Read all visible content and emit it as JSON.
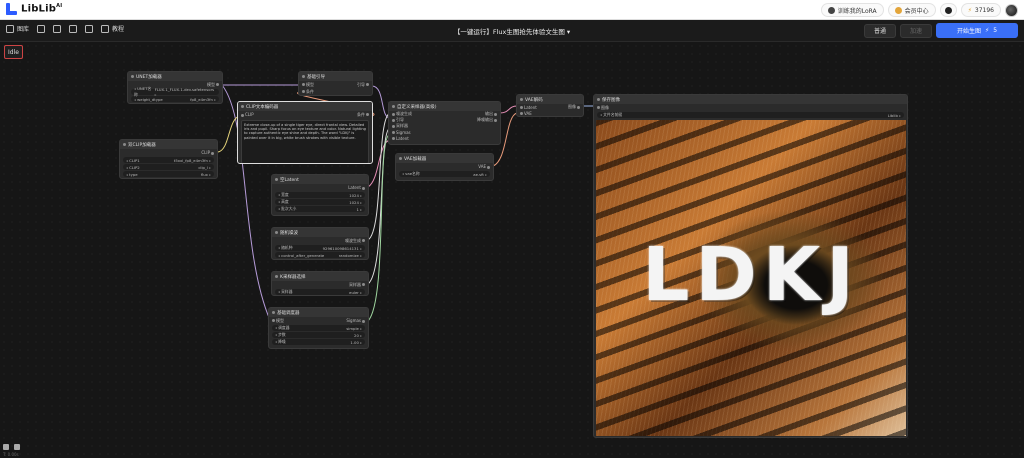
{
  "brand": {
    "logo_text": "LibLib",
    "logo_sup": "AI"
  },
  "topbar": {
    "train_lora": "训练我的LoRA",
    "member_center": "会员中心",
    "points": "37196"
  },
  "toolbar": {
    "library": "图库",
    "tutorial": "教程",
    "workflow_title": "【一键运行】Flux生图抢先体验文生图",
    "mode_normal": "普通",
    "mode_fast": "加速",
    "run_button": "开始生图",
    "run_cost": "5"
  },
  "canvas": {
    "status": "Idle",
    "footer_status": "T: 0.00s"
  },
  "nodes": {
    "unet": {
      "title": "UNET加载器",
      "out_model": "模型",
      "unet_name": "FLUX.1_FLUX.1-dev.safetensors",
      "unet_label": "UNET名称",
      "weight_dtype_label": "weight_dtype",
      "weight_dtype": "fp8_e4m3fn"
    },
    "dualclip": {
      "title": "双CLIP加载器",
      "out_clip": "CLIP",
      "clip1_label": "CLIP1",
      "clip1": "t5xxl_fp8_e4m3fn",
      "clip2_label": "CLIP2",
      "clip2": "clip_l",
      "type_label": "type",
      "type": "flux"
    },
    "clip_encode": {
      "title": "CLIP文本编码器",
      "in_clip": "CLIP",
      "out_cond": "条件",
      "prompt": "Extreme close-up of a single tiger eye, direct frontal view. Detailed iris and pupil. Sharp focus on eye texture and color. Natural lighting to capture authentic eye shine and depth. The word \"LDKJ\" is painted over it in big, white brush strokes with visible texture."
    },
    "guider": {
      "title": "基础引导",
      "in_model": "模型",
      "in_cond": "条件",
      "out_guider": "引导"
    },
    "sampler_custom": {
      "title": "自定义采样器(高级)",
      "in_noise": "噪波生成",
      "in_guider": "引导",
      "in_sampler": "采样器",
      "in_sigmas": "Sigmas",
      "in_latent": "Latent",
      "out": "输出",
      "out_denoised": "降噪输出"
    },
    "vae_decode": {
      "title": "VAE解码",
      "in_latent": "Latent",
      "in_vae": "VAE",
      "out_image": "图像"
    },
    "vae_loader": {
      "title": "VAE加载器",
      "out_vae": "VAE",
      "vae_label": "vae名称",
      "vae_name": "ae.sft"
    },
    "empty_latent": {
      "title": "空Latent",
      "out": "Latent",
      "width_label": "宽度",
      "width": "1024",
      "height_label": "高度",
      "height": "1024",
      "batch_label": "批次大小",
      "batch": "1"
    },
    "noise": {
      "title": "随机噪波",
      "out": "噪波生成",
      "seed_label": "随机种",
      "seed": "929610098614131",
      "control_label": "control_after_generate",
      "control": "randomize"
    },
    "ksampler_select": {
      "title": "K采样器选择",
      "out": "采样器",
      "sampler_label": "采样器",
      "sampler": "euler"
    },
    "scheduler": {
      "title": "基础调度器",
      "in_model": "模型",
      "out": "Sigmas",
      "sched_label": "调度器",
      "sched": "simple",
      "steps_label": "步数",
      "steps": "20",
      "denoise_label": "降噪",
      "denoise": "1.00"
    },
    "save_image": {
      "title": "保存图像",
      "in_image": "图像",
      "prefix_label": "文件名前缀",
      "prefix": "Liblib",
      "image_text": "LDKJ"
    }
  },
  "colors": {
    "accent": "#3a6ff7",
    "wire_purple": "#b59bd8",
    "wire_yellow": "#e6d47a",
    "wire_orange": "#e69a7a",
    "wire_green": "#9fd59f",
    "wire_pink": "#e58fb6"
  }
}
